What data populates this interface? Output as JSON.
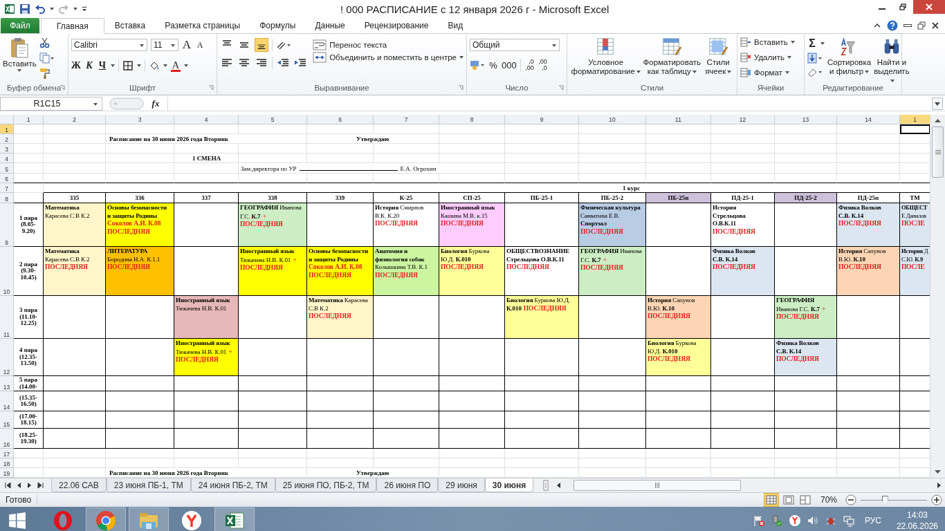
{
  "window": {
    "title": "! 000 РАСПИСАНИЕ с 12 января 2026 г  -  Microsoft Excel"
  },
  "ribbon_tabs": [
    {
      "label": "Файл",
      "kind": "file",
      "selected": false
    },
    {
      "label": "Главная",
      "kind": "tab",
      "selected": true
    },
    {
      "label": "Вставка",
      "kind": "tab",
      "selected": false
    },
    {
      "label": "Разметка страницы",
      "kind": "tab",
      "selected": false
    },
    {
      "label": "Формулы",
      "kind": "tab",
      "selected": false
    },
    {
      "label": "Данные",
      "kind": "tab",
      "selected": false
    },
    {
      "label": "Рецензирование",
      "kind": "tab",
      "selected": false
    },
    {
      "label": "Вид",
      "kind": "tab",
      "selected": false
    }
  ],
  "ribbon": {
    "clipboard": {
      "paste": "Вставить",
      "label": "Буфер обмена"
    },
    "font": {
      "name": "Calibri",
      "size": "11",
      "grow": "A",
      "shrink": "A",
      "bold": "Ж",
      "italic": "К",
      "underline": "Ч",
      "color_letter": "A",
      "label": "Шрифт"
    },
    "alignment": {
      "vertical": [
        {
          "selected": false
        },
        {
          "selected": false
        },
        {
          "selected": true
        }
      ],
      "wrap": "Перенос текста",
      "merge": "Объединить и поместить в центре",
      "label": "Выравнивание"
    },
    "number": {
      "format": "Общий",
      "percent": "%",
      "thousands": "000",
      "increase_decimal": [
        ",0",
        ",00"
      ],
      "decrease_decimal": [
        ",00",
        ",0"
      ],
      "label": "Число"
    },
    "styles": {
      "buttons": [
        "Условное форматирование",
        "Форматировать как таблицу",
        "Стили ячеек"
      ],
      "label": "Стили"
    },
    "cells": {
      "buttons": [
        "Вставить",
        "Удалить",
        "Формат"
      ],
      "label": "Ячейки"
    },
    "editing": {
      "sum": "Σ",
      "buttons": [
        "Сортировка и фильтр",
        "Найти и выделить"
      ],
      "label": "Редактирование"
    }
  },
  "formula_bar": {
    "name_box": "R1C15",
    "fx": "fx"
  },
  "sheet": {
    "column_headers": [
      {
        "label": "1",
        "selected": false
      },
      {
        "label": "2",
        "selected": false
      },
      {
        "label": "3",
        "selected": false
      },
      {
        "label": "4",
        "selected": false
      },
      {
        "label": "5",
        "selected": false
      },
      {
        "label": "6",
        "selected": false
      },
      {
        "label": "7",
        "selected": false
      },
      {
        "label": "8",
        "selected": false
      },
      {
        "label": "9",
        "selected": false
      },
      {
        "label": "10",
        "selected": false
      },
      {
        "label": "11",
        "selected": false
      },
      {
        "label": "12",
        "selected": false
      },
      {
        "label": "13",
        "selected": false
      },
      {
        "label": "14",
        "selected": false
      },
      {
        "label": "1",
        "selected": true
      }
    ],
    "row_headers": [
      {
        "label": "1",
        "selected": true
      },
      {
        "label": "2",
        "selected": false
      },
      {
        "label": "3",
        "selected": false
      },
      {
        "label": "4",
        "selected": false
      },
      {
        "label": "5",
        "selected": false
      },
      {
        "label": "6",
        "selected": false
      },
      {
        "label": "7",
        "selected": false
      },
      {
        "label": "8",
        "selected": false
      },
      {
        "label": "9",
        "selected": false
      },
      {
        "label": "10",
        "selected": false
      },
      {
        "label": "11",
        "selected": false
      },
      {
        "label": "12",
        "selected": false
      },
      {
        "label": "13",
        "selected": false
      },
      {
        "label": "14",
        "selected": false
      },
      {
        "label": "15",
        "selected": false
      },
      {
        "label": "16",
        "selected": false
      },
      {
        "label": "17",
        "selected": false
      },
      {
        "label": "18",
        "selected": false
      },
      {
        "label": "19",
        "selected": false
      }
    ],
    "header": {
      "title": "Расписание на 30 июня 2026 года  Вторник",
      "approve": "Утверждаю",
      "shift": "1 СМЕНА",
      "deputy": "Зам.директора по УР",
      "deputy_name": "Е.А. Огрохин",
      "course": "1 курс"
    },
    "footer": {
      "title": "Расписание на 30 июня 2026 года  Вторник",
      "approve": "Утверждаю"
    },
    "groups": [
      {
        "label": "335"
      },
      {
        "label": "336"
      },
      {
        "label": "337"
      },
      {
        "label": "338"
      },
      {
        "label": "339"
      },
      {
        "label": "К-25"
      },
      {
        "label": "СП-25"
      },
      {
        "label": "ПБ-25-1"
      },
      {
        "label": "ПБ-25-2"
      },
      {
        "label": "ПБ-25п",
        "color": "#ccc0da"
      },
      {
        "label": "ПД-25-1"
      },
      {
        "label": "ПД-25-2",
        "color": "#ccc0da"
      },
      {
        "label": "ПД-25п"
      },
      {
        "label": "ТМ"
      }
    ],
    "rows": [
      {
        "label": "1 пара (8.05- 9.20)",
        "cells": [
          {
            "color": "#fff5c9",
            "parts": [
              {
                "kind": "text",
                "text": "**Математика**"
              },
              {
                "kind": "text",
                "text": "Карасева С.В К.2"
              }
            ]
          },
          {
            "color": "#ffff00",
            "parts": [
              {
                "kind": "text",
                "text": "**Основы безопасности**"
              },
              {
                "kind": "text",
                "text": "**и защиты Родины**"
              },
              {
                "kind": "alert",
                "text": "Соколов А.И. К.08"
              },
              {
                "kind": "alert",
                "text": "ПОСЛЕДНЯЯ"
              }
            ]
          },
          null,
          {
            "color": "#cdeec4",
            "parts": [
              {
                "kind": "text",
                "text": "**ГЕОГРАФИЯ** Иванова"
              },
              {
                "kind": "text",
                "text": "Г.С. **К.7**"
              },
              {
                "kind": "plus",
                "text": "+"
              },
              {
                "kind": "alert",
                "text": "ПОСЛЕДНЯЯ"
              }
            ]
          },
          null,
          {
            "parts": [
              {
                "kind": "text",
                "text": "**История** Смирнов"
              },
              {
                "kind": "text",
                "text": "В.К. К.20"
              },
              {
                "kind": "alert",
                "text": "ПОСЛЕДНЯЯ"
              }
            ]
          },
          {
            "color": "#ffccff",
            "parts": [
              {
                "kind": "text",
                "text": "**Иностранный язык**"
              },
              {
                "kind": "text",
                "text": "Кашина М.В. к.15"
              },
              {
                "kind": "alert",
                "text": "ПОСЛЕДНЯЯ"
              }
            ]
          },
          null,
          {
            "color": "#b8cce4",
            "parts": [
              {
                "kind": "text",
                "text": "**Физическая культура**"
              },
              {
                "kind": "text",
                "text": "Савватина Е.В."
              },
              {
                "kind": "text",
                "text": "**Спортзал**"
              },
              {
                "kind": "alert",
                "text": "ПОСЛЕДНЯЯ"
              }
            ]
          },
          null,
          {
            "parts": [
              {
                "kind": "text",
                "text": "**История**"
              },
              {
                "kind": "text",
                "text": "**Стрельцова**"
              },
              {
                "kind": "text",
                "text": "**О.В.К.11**"
              },
              {
                "kind": "alert",
                "text": "ПОСЛЕДНЯЯ"
              }
            ]
          },
          null,
          {
            "color": "#dce6f1",
            "parts": [
              {
                "kind": "text",
                "text": "**Физика  Волков**"
              },
              {
                "kind": "text",
                "text": "**С.В. К.14**"
              },
              {
                "kind": "alert",
                "text": "ПОСЛЕДНЯЯ"
              }
            ]
          },
          {
            "color": "#dce6f1",
            "parts": [
              {
                "kind": "text",
                "text": "**ОБЩЕСТ**"
              },
              {
                "kind": "text",
                "text": "Е Данилов"
              },
              {
                "kind": "alert",
                "text": "ПОСЛЕ"
              }
            ]
          }
        ]
      },
      {
        "label": "2 пара (9.30- 10.45)",
        "cells": [
          {
            "color": "#fff5c9",
            "parts": [
              {
                "kind": "text",
                "text": "**Математика**"
              },
              {
                "kind": "text",
                "text": "Карасева С.В К.2"
              },
              {
                "kind": "alert",
                "text": "ПОСЛЕДНЯЯ"
              }
            ]
          },
          {
            "color": "#ffc000",
            "parts": [
              {
                "kind": "text",
                "text": "**ЛИТЕРАТУРА**"
              },
              {
                "kind": "text",
                "text": "Бородина Н.А. К.1.1"
              },
              {
                "kind": "alert",
                "text": "ПОСЛЕДНЯЯ"
              }
            ]
          },
          null,
          {
            "color": "#ffff00",
            "parts": [
              {
                "kind": "text",
                "text": "**Иностранный язык**"
              },
              {
                "kind": "text",
                "text": "Тюкачева Н.В. К.01"
              },
              {
                "kind": "plus",
                "text": "+"
              },
              {
                "kind": "alert",
                "text": "ПОСЛЕДНЯЯ"
              }
            ]
          },
          {
            "color": "#ffff00",
            "parts": [
              {
                "kind": "text",
                "text": "**Основы безопасности**"
              },
              {
                "kind": "text",
                "text": "**и защиты Родины**"
              },
              {
                "kind": "alert",
                "text": "Соколов А.И. К.08"
              },
              {
                "kind": "alert",
                "text": "ПОСЛЕДНЯЯ"
              }
            ]
          },
          {
            "color": "#ccf5a0",
            "parts": [
              {
                "kind": "text",
                "text": "**Анатомия и**"
              },
              {
                "kind": "text",
                "text": "**физиология собак**"
              },
              {
                "kind": "text",
                "text": "Колышкина Т.В. К.1"
              },
              {
                "kind": "alert",
                "text": "ПОСЛЕДНЯЯ"
              }
            ]
          },
          {
            "color": "#ffff99",
            "parts": [
              {
                "kind": "text",
                "text": "**Биология** Буркова"
              },
              {
                "kind": "text",
                "text": "Ю.Д. **К.010**"
              },
              {
                "kind": "alert",
                "text": "ПОСЛЕДНЯЯ"
              }
            ]
          },
          {
            "parts": [
              {
                "kind": "text",
                "text": "**ОБЩЕСТВОЗНАНИЕ**"
              },
              {
                "kind": "text",
                "text": "**Стрельцова О.В.К.11**"
              },
              {
                "kind": "alert",
                "text": "ПОСЛЕДНЯЯ"
              }
            ]
          },
          {
            "color": "#cdeec4",
            "parts": [
              {
                "kind": "text",
                "text": "**ГЕОГРАФИЯ** Иванова"
              },
              {
                "kind": "text",
                "text": "Г.С. **К.7**"
              },
              {
                "kind": "plus",
                "text": "+"
              },
              {
                "kind": "alert",
                "text": "ПОСЛЕДНЯЯ"
              }
            ]
          },
          null,
          {
            "color": "#dce6f1",
            "parts": [
              {
                "kind": "text",
                "text": "**Физика  Волков**"
              },
              {
                "kind": "text",
                "text": "**С.В. К.14**"
              },
              {
                "kind": "alert",
                "text": "ПОСЛЕДНЯЯ"
              }
            ]
          },
          null,
          {
            "color": "#fcd5b4",
            "parts": [
              {
                "kind": "text",
                "text": "**История** Сапунов"
              },
              {
                "kind": "text",
                "text": "В.Ю. **К.10**"
              },
              {
                "kind": "alert",
                "text": "ПОСЛЕДНЯЯ"
              }
            ]
          },
          {
            "color": "#dce6f1",
            "parts": [
              {
                "kind": "text",
                "text": "**История** Д"
              },
              {
                "kind": "text",
                "text": "С.Ю. **К.9**"
              },
              {
                "kind": "alert",
                "text": "ПОСЛЕ"
              }
            ]
          }
        ]
      },
      {
        "label": "3 пара (11.10- 12.25)",
        "cells": [
          null,
          null,
          {
            "color": "#e6b8b7",
            "parts": [
              {
                "kind": "text",
                "text": "**Иностранный язык**"
              },
              {
                "kind": "text",
                "text": "Тюкачева Н.В. К.01"
              }
            ]
          },
          null,
          {
            "color": "#fff5c9",
            "parts": [
              {
                "kind": "text",
                "text": "**Математика** Карасева"
              },
              {
                "kind": "text",
                "text": "С.В К.2"
              },
              {
                "kind": "alert",
                "text": "ПОСЛЕДНЯЯ"
              }
            ]
          },
          null,
          null,
          {
            "color": "#ffff99",
            "parts": [
              {
                "kind": "text",
                "text": "**Биология** Буркова Ю.Д."
              },
              {
                "kind": "text",
                "text": "**К.010**"
              },
              {
                "kind": "tail",
                "text": "ПОСЛЕДНЯЯ"
              }
            ]
          },
          null,
          {
            "color": "#fcd5b4",
            "parts": [
              {
                "kind": "text",
                "text": "**История** Сапунов"
              },
              {
                "kind": "text",
                "text": "В.Ю. **К.10**"
              },
              {
                "kind": "alert",
                "text": "ПОСЛЕДНЯЯ"
              }
            ]
          },
          null,
          {
            "color": "#cdeec4",
            "parts": [
              {
                "kind": "text",
                "text": "**ГЕОГРАФИЯ**"
              },
              {
                "kind": "text",
                "text": "Иванова Г.С. **К.7**"
              },
              {
                "kind": "plus",
                "text": "+"
              },
              {
                "kind": "alert",
                "text": "ПОСЛЕДНЯЯ"
              }
            ]
          },
          null,
          null
        ]
      },
      {
        "label": "4 пара (12.35- 13.50)",
        "cells": [
          null,
          null,
          {
            "color": "#ffff00",
            "parts": [
              {
                "kind": "text",
                "text": "**Иностранный язык**"
              },
              {
                "kind": "text",
                "text": "Тюкачева Н.В. К.01"
              },
              {
                "kind": "plus",
                "text": "+"
              },
              {
                "kind": "alert",
                "text": "ПОСЛЕДНЯЯ"
              }
            ]
          },
          null,
          null,
          null,
          null,
          null,
          null,
          {
            "color": "#ffff99",
            "parts": [
              {
                "kind": "text",
                "text": "**Биология** Буркова"
              },
              {
                "kind": "text",
                "text": "Ю.Д. **К.010**"
              },
              {
                "kind": "alert",
                "text": "ПОСЛЕДНЯЯ"
              }
            ]
          },
          null,
          {
            "color": "#dce6f1",
            "parts": [
              {
                "kind": "text",
                "text": "**Физика  Волков**"
              },
              {
                "kind": "text",
                "text": "**С.В. К.14**"
              },
              {
                "kind": "alert",
                "text": "ПОСЛЕДНЯЯ"
              }
            ]
          },
          null,
          null
        ]
      },
      {
        "label": "5 пара (14.00-"
      },
      {
        "label": "(15.35- 16.50)"
      },
      {
        "label": "(17.00- 18.15)"
      },
      {
        "label": "(18.25- 19.30)"
      }
    ]
  },
  "sheet_tabs": [
    {
      "label": "22.06 САВ",
      "selected": false
    },
    {
      "label": "23 июня ПБ-1, ТМ",
      "selected": false
    },
    {
      "label": "24 июня ПБ-2, ТМ",
      "selected": false
    },
    {
      "label": "25 июня ПО, ПБ-2, ТМ",
      "selected": false
    },
    {
      "label": "26 июня ПО",
      "selected": false
    },
    {
      "label": "29 июня",
      "selected": false
    },
    {
      "label": "30 июня",
      "selected": true
    }
  ],
  "status_bar": {
    "ready": "Готово",
    "views": [
      {
        "selected": true
      },
      {
        "selected": false
      },
      {
        "selected": false
      }
    ],
    "zoom": "70%",
    "zoom_slider": {
      "level": 0.37
    }
  },
  "taskbar": {
    "apps": [
      {
        "kind": "opera",
        "running": false
      },
      {
        "kind": "chrome",
        "running": true
      },
      {
        "kind": "explorer",
        "running": true
      },
      {
        "kind": "yandex",
        "running": false
      },
      {
        "kind": "excel",
        "running": true
      }
    ],
    "language": "РУС",
    "time": "14:03",
    "date": "22.06.2026"
  }
}
